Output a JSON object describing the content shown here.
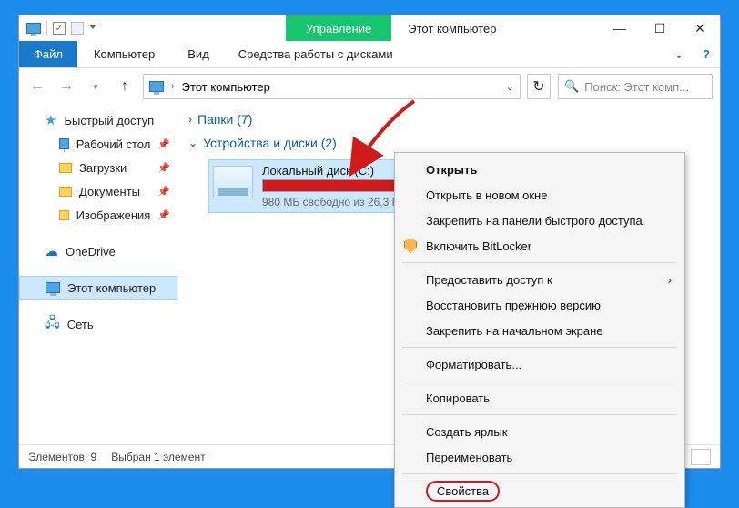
{
  "title": "Этот компьютер",
  "qat": {
    "checked": true
  },
  "ribbon": {
    "manage": "Управление",
    "file": "Файл",
    "computer": "Компьютер",
    "view": "Вид",
    "tools": "Средства работы с дисками"
  },
  "address": {
    "location": "Этот компьютер",
    "search_placeholder": "Поиск: Этот комп..."
  },
  "sidebar": {
    "quick_access": "Быстрый доступ",
    "desktop": "Рабочий стол",
    "downloads": "Загрузки",
    "documents": "Документы",
    "pictures": "Изображения",
    "onedrive": "OneDrive",
    "this_pc": "Этот компьютер",
    "network": "Сеть"
  },
  "content": {
    "folders_group": "Папки (7)",
    "devices_group": "Устройства и диски (2)",
    "drive": {
      "name": "Локальный диск (C:)",
      "free": "980 МБ свободно из 26,3 ГБ"
    }
  },
  "context_menu": {
    "open": "Открыть",
    "open_new": "Открыть в новом окне",
    "pin_quick": "Закрепить на панели быстрого доступа",
    "bitlocker": "Включить BitLocker",
    "share": "Предоставить доступ к",
    "restore": "Восстановить прежнюю версию",
    "pin_start": "Закрепить на начальном экране",
    "format": "Форматировать...",
    "copy": "Копировать",
    "shortcut": "Создать ярлык",
    "rename": "Переименовать",
    "properties": "Свойства"
  },
  "statusbar": {
    "items": "Элементов: 9",
    "selected": "Выбран 1 элемент"
  }
}
